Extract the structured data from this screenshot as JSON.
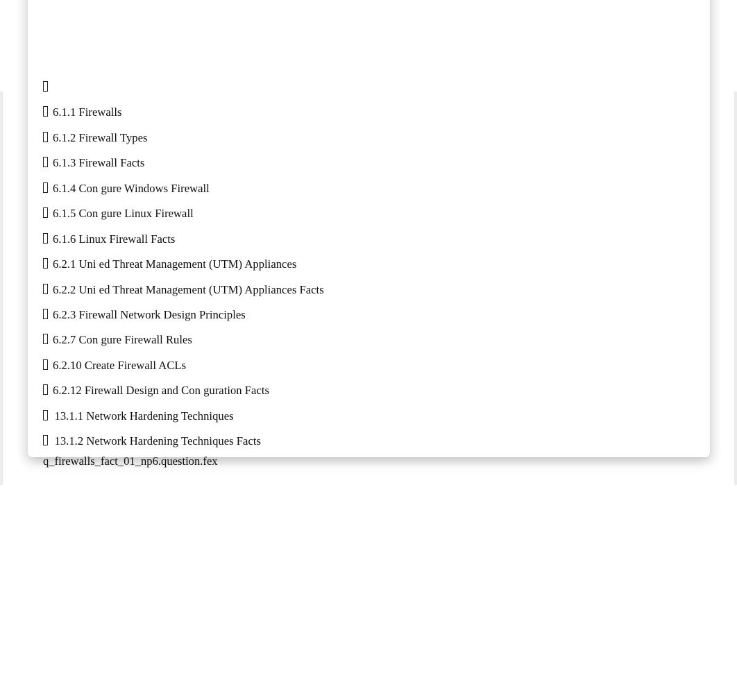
{
  "document": {
    "page_background": "#ffffff",
    "text_color": "#0e0e0e",
    "bullet_glyph_name": "missing-glyph-tofu-box",
    "toc_items": [
      {
        "bullet": "□",
        "label": "",
        "indent": "normal"
      },
      {
        "bullet": "□",
        "label": "6.1.1 Firewalls",
        "indent": "normal"
      },
      {
        "bullet": "□",
        "label": "6.1.2 Firewall Types",
        "indent": "normal"
      },
      {
        "bullet": "□",
        "label": "6.1.3 Firewall Facts",
        "indent": "normal"
      },
      {
        "bullet": "□",
        "label": "6.1.4 Con gure Windows Firewall",
        "indent": "normal"
      },
      {
        "bullet": "□",
        "label": "6.1.5 Con gure Linux Firewall",
        "indent": "normal"
      },
      {
        "bullet": "□",
        "label": "6.1.6 Linux Firewall Facts",
        "indent": "normal"
      },
      {
        "bullet": "□",
        "label": "6.2.1 Uni ed Threat Management (UTM) Appliances",
        "indent": "normal"
      },
      {
        "bullet": "□",
        "label": "6.2.2 Uni ed Threat Management (UTM) Appliances Facts",
        "indent": "normal"
      },
      {
        "bullet": "□",
        "label": "6.2.3 Firewall Network Design Principles",
        "indent": "normal"
      },
      {
        "bullet": "□",
        "label": "6.2.7 Con gure Firewall Rules",
        "indent": "normal"
      },
      {
        "bullet": "□",
        "label": "6.2.10 Create Firewall ACLs",
        "indent": "normal"
      },
      {
        "bullet": "□",
        "label": "6.2.12 Firewall Design and Con guration Facts",
        "indent": "normal"
      },
      {
        "bullet": "□",
        "label": "13.1.1 Network Hardening Techniques",
        "indent": "deep"
      },
      {
        "bullet": "□",
        "label": "13.1.2 Network Hardening Techniques Facts",
        "indent": "deep"
      }
    ],
    "footer_filename": "q_firewalls_fact_01_np6.question.fex"
  }
}
